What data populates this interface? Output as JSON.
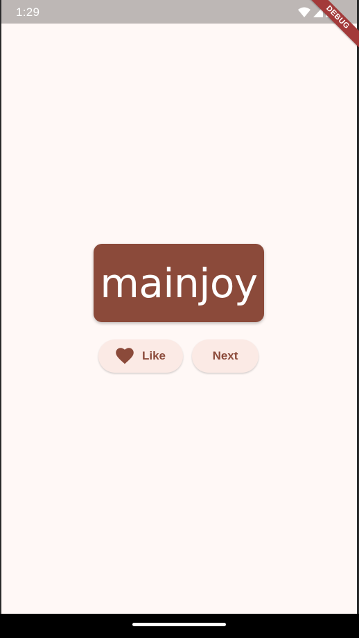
{
  "status_bar": {
    "time": "1:29",
    "icons": [
      "wifi-icon",
      "signal-icon",
      "battery-icon"
    ]
  },
  "debug_banner": {
    "label": "DEBUG"
  },
  "main": {
    "word": "mainjoy",
    "like_button": {
      "label": "Like",
      "icon": "heart-icon"
    },
    "next_button": {
      "label": "Next"
    }
  },
  "colors": {
    "background": "#fff8f6",
    "primary": "#8b4a3a",
    "button_bg": "#fbeae5",
    "debug": "#a33a3a"
  }
}
